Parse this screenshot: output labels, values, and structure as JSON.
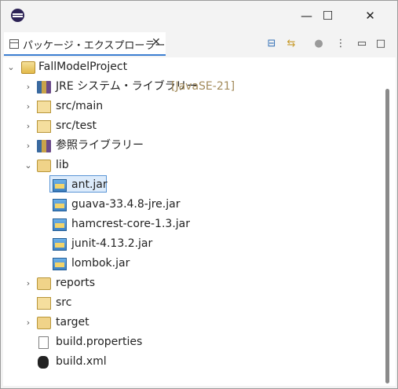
{
  "window": {
    "minimize_symbol": "—",
    "maximize_symbol": "☐",
    "close_symbol": "✕"
  },
  "tab": {
    "label": "パッケージ・エクスプローラー",
    "close_symbol": "✕"
  },
  "toolbar": {
    "collapse_symbol": "⊟",
    "link_symbol": "⇆",
    "filter_symbol": "●",
    "menu_symbol": "⋮",
    "minimize_symbol": "▭",
    "maximize_symbol": "□"
  },
  "tree": {
    "project": "FallModelProject",
    "jre": "JRE システム・ライブラリー",
    "jre_decoration": "[JavaSE-21]",
    "src_main": "src/main",
    "src_test": "src/test",
    "ref_libs": "参照ライブラリー",
    "lib": "lib",
    "jars": [
      "ant.jar",
      "guava-33.4.8-jre.jar",
      "hamcrest-core-1.3.jar",
      "junit-4.13.2.jar",
      "lombok.jar"
    ],
    "reports": "reports",
    "src": "src",
    "target": "target",
    "build_properties": "build.properties",
    "build_xml": "build.xml"
  }
}
